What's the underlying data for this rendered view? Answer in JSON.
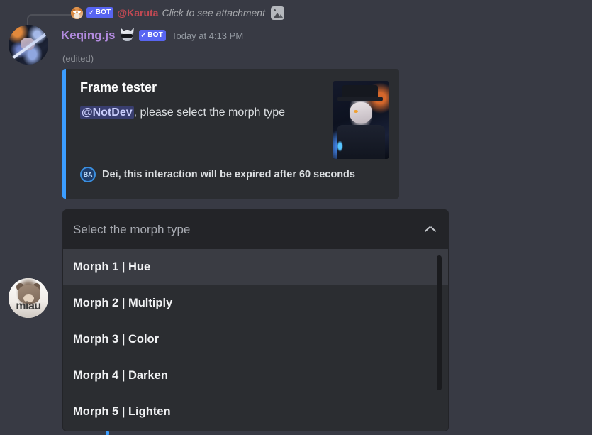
{
  "theme": {
    "page_bg": "#383a44",
    "embed_bg": "#2b2d31",
    "embed_accent": "#3b9dff",
    "bot_badge_bg": "#5865f2",
    "reply_author_color": "#c14953",
    "author_color": "#b38be0",
    "option_hover_bg": "#3a3c43",
    "select_header_bg": "#232428"
  },
  "reply": {
    "avatar": "karuta-avatar",
    "bot_label": "BOT",
    "bot_check": "✓",
    "author": "@Karuta",
    "preview_text": "Click to see attachment",
    "attachment_icon": "image-icon"
  },
  "message": {
    "avatar": "keqing-avatar",
    "author": "Keqing.js",
    "emoji": "skull-sunglasses-emoji",
    "bot_label": "BOT",
    "bot_check": "✓",
    "timestamp": "Today at 4:13 PM",
    "edited_label": "(edited)"
  },
  "embed": {
    "title": "Frame tester",
    "mention": "@NotDev",
    "description_rest": ", please select the morph type",
    "thumbnail": "anime-character-thumbnail",
    "footer": {
      "icon_label": "BA",
      "text": "Dei, this interaction will be expired after 60 seconds"
    }
  },
  "select_menu": {
    "placeholder": "Select the morph type",
    "expanded": true,
    "chevron": "chevron-up-icon",
    "options": [
      {
        "label": "Morph 1 | Hue",
        "hovered": true
      },
      {
        "label": "Morph 2 | Multiply",
        "hovered": false
      },
      {
        "label": "Morph 3 | Color",
        "hovered": false
      },
      {
        "label": "Morph 4 | Darken",
        "hovered": false
      },
      {
        "label": "Morph 5 | Lighten",
        "hovered": false
      }
    ]
  },
  "second_message": {
    "avatar": "miau-cat-avatar",
    "avatar_text": "miau"
  }
}
